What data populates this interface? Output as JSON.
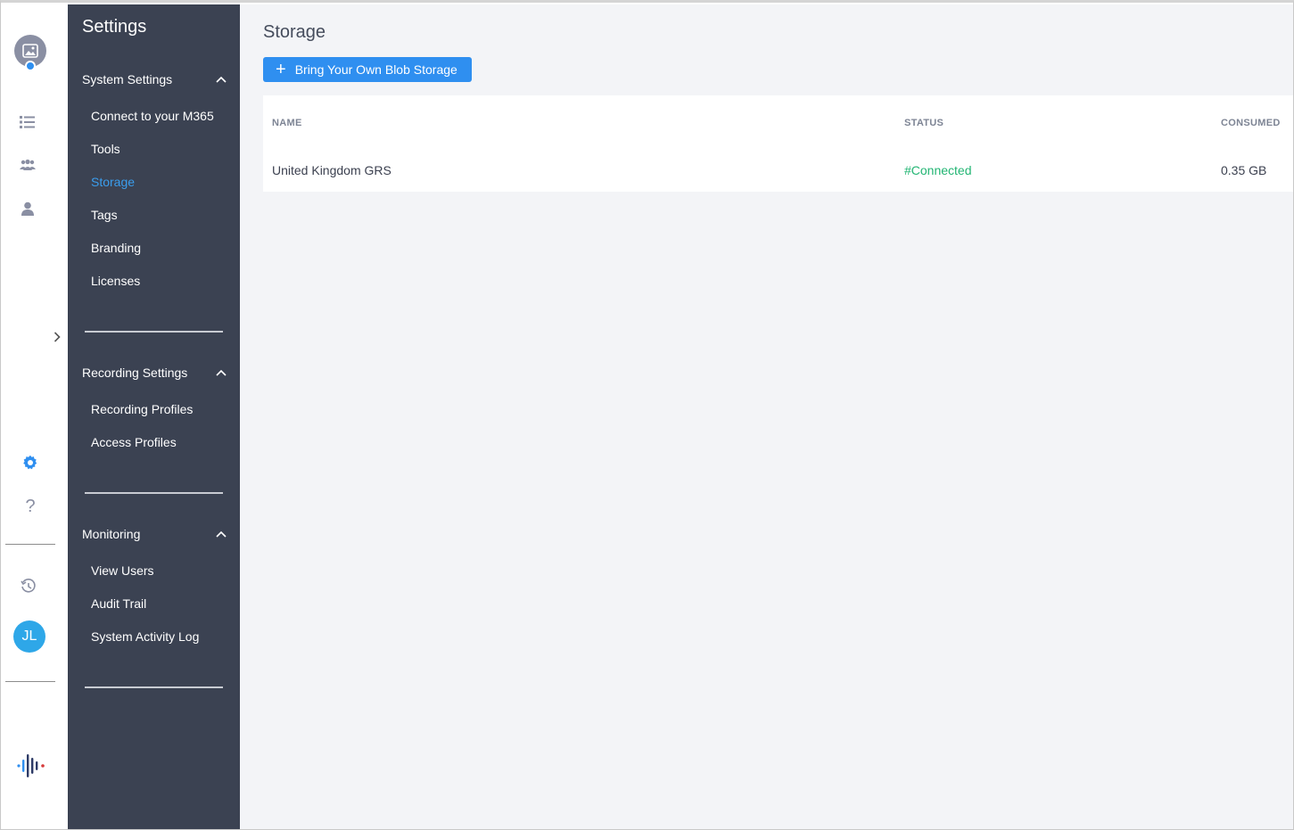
{
  "nav": {
    "title": "Settings",
    "sections": [
      {
        "label": "System Settings",
        "items": [
          {
            "label": "Connect to your M365"
          },
          {
            "label": "Tools"
          },
          {
            "label": "Storage",
            "active": true
          },
          {
            "label": "Tags"
          },
          {
            "label": "Branding"
          },
          {
            "label": "Licenses"
          }
        ]
      },
      {
        "label": "Recording Settings",
        "items": [
          {
            "label": "Recording Profiles"
          },
          {
            "label": "Access Profiles"
          }
        ]
      },
      {
        "label": "Monitoring",
        "items": [
          {
            "label": "View Users"
          },
          {
            "label": "Audit Trail"
          },
          {
            "label": "System Activity Log"
          }
        ]
      }
    ]
  },
  "rail": {
    "icons": [
      "image-avatar-icon",
      "list-icon",
      "group-icon",
      "user-icon",
      "gear-icon",
      "help-icon",
      "history-icon",
      "app-logo-icon"
    ],
    "user_initials": "JL",
    "help_glyph": "?"
  },
  "main": {
    "title": "Storage",
    "add_button": {
      "icon": "plus-icon",
      "label": "Bring Your Own Blob Storage"
    },
    "table": {
      "headers": [
        "NAME",
        "STATUS",
        "CONSUMED"
      ],
      "rows": [
        {
          "name": "United Kingdom GRS",
          "status": "#Connected",
          "consumed": "0.35 GB"
        }
      ]
    }
  },
  "colors": {
    "accent": "#2f8ff0",
    "nav_bg": "#3b4252",
    "status_connected": "#22b573",
    "main_bg": "#f3f4f7"
  }
}
